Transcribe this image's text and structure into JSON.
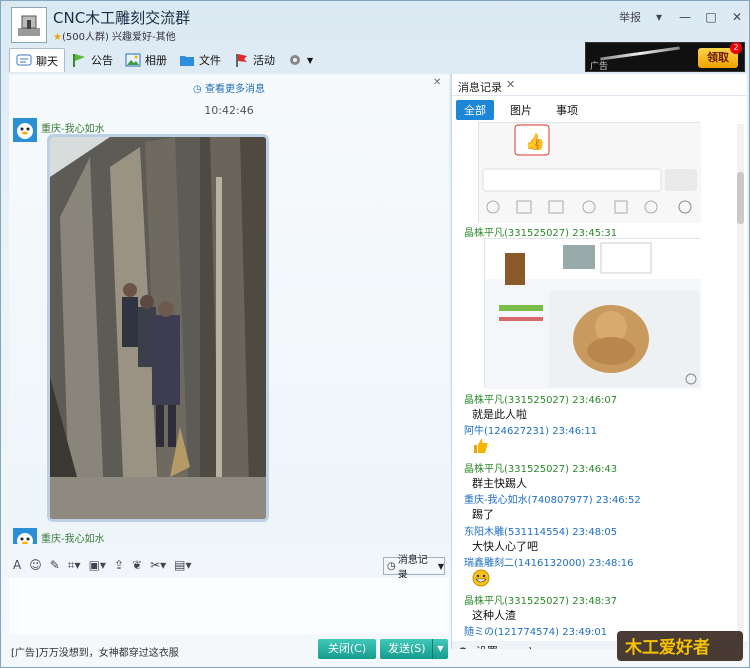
{
  "title": {
    "group_name": "CNC木工雕刻交流群",
    "member_info": "(500人群) 兴趣爱好-其他"
  },
  "window_controls": {
    "report": "举报",
    "menu": "▾",
    "minimize": "—",
    "maximize": "□",
    "close": "✕"
  },
  "toolbar": {
    "chat": "聊天",
    "notice": "公告",
    "album": "相册",
    "files": "文件",
    "events": "活动"
  },
  "ad": {
    "label": "广告",
    "button": "领取",
    "badge": "2"
  },
  "chat": {
    "more_messages": "查看更多消息",
    "time": "10:42:46",
    "messages": [
      {
        "sender": "重庆-我心如水"
      },
      {
        "sender": "重庆-我心如水"
      }
    ]
  },
  "input_toolbar": {
    "history_button": "消息记录"
  },
  "bottom": {
    "ad_text": "[广告]万万没想到，女神都穿过这衣服",
    "close_button": "关闭(C)",
    "send_button": "发送(S)"
  },
  "history": {
    "tab_label": "消息记录",
    "filters": [
      "全部",
      "图片",
      "事项"
    ],
    "entries": [
      {
        "head": "晶株平凡(331525027) 23:45:31",
        "color": "#2a8a2a"
      },
      {
        "head": "晶株平凡(331525027) 23:46:07",
        "color": "#2a8a2a",
        "text": "就是此人啦"
      },
      {
        "head": "阿牛(124627231) 23:46:11",
        "color": "#1d6fc2"
      },
      {
        "head": "晶株平凡(331525027) 23:46:43",
        "color": "#2a8a2a",
        "text": "群主快踢人"
      },
      {
        "head": "重庆-我心如水(740807977) 23:46:52",
        "color": "#1d6fc2",
        "text": "踢了"
      },
      {
        "head": "东阳木雕(531114554) 23:48:05",
        "color": "#1d6fc2",
        "text": "大快人心了吧"
      },
      {
        "head": "瑞鑫雕刻二(1416132000) 23:48:16",
        "color": "#1d6fc2"
      },
      {
        "head": "晶株平凡(331525027) 23:48:37",
        "color": "#2a8a2a",
        "text": "这种人渣"
      },
      {
        "head": "随ミの(121774574) 23:49:01",
        "color": "#1d6fc2"
      }
    ],
    "footer_settings": "设置"
  },
  "logo_text": "木工爱好者"
}
